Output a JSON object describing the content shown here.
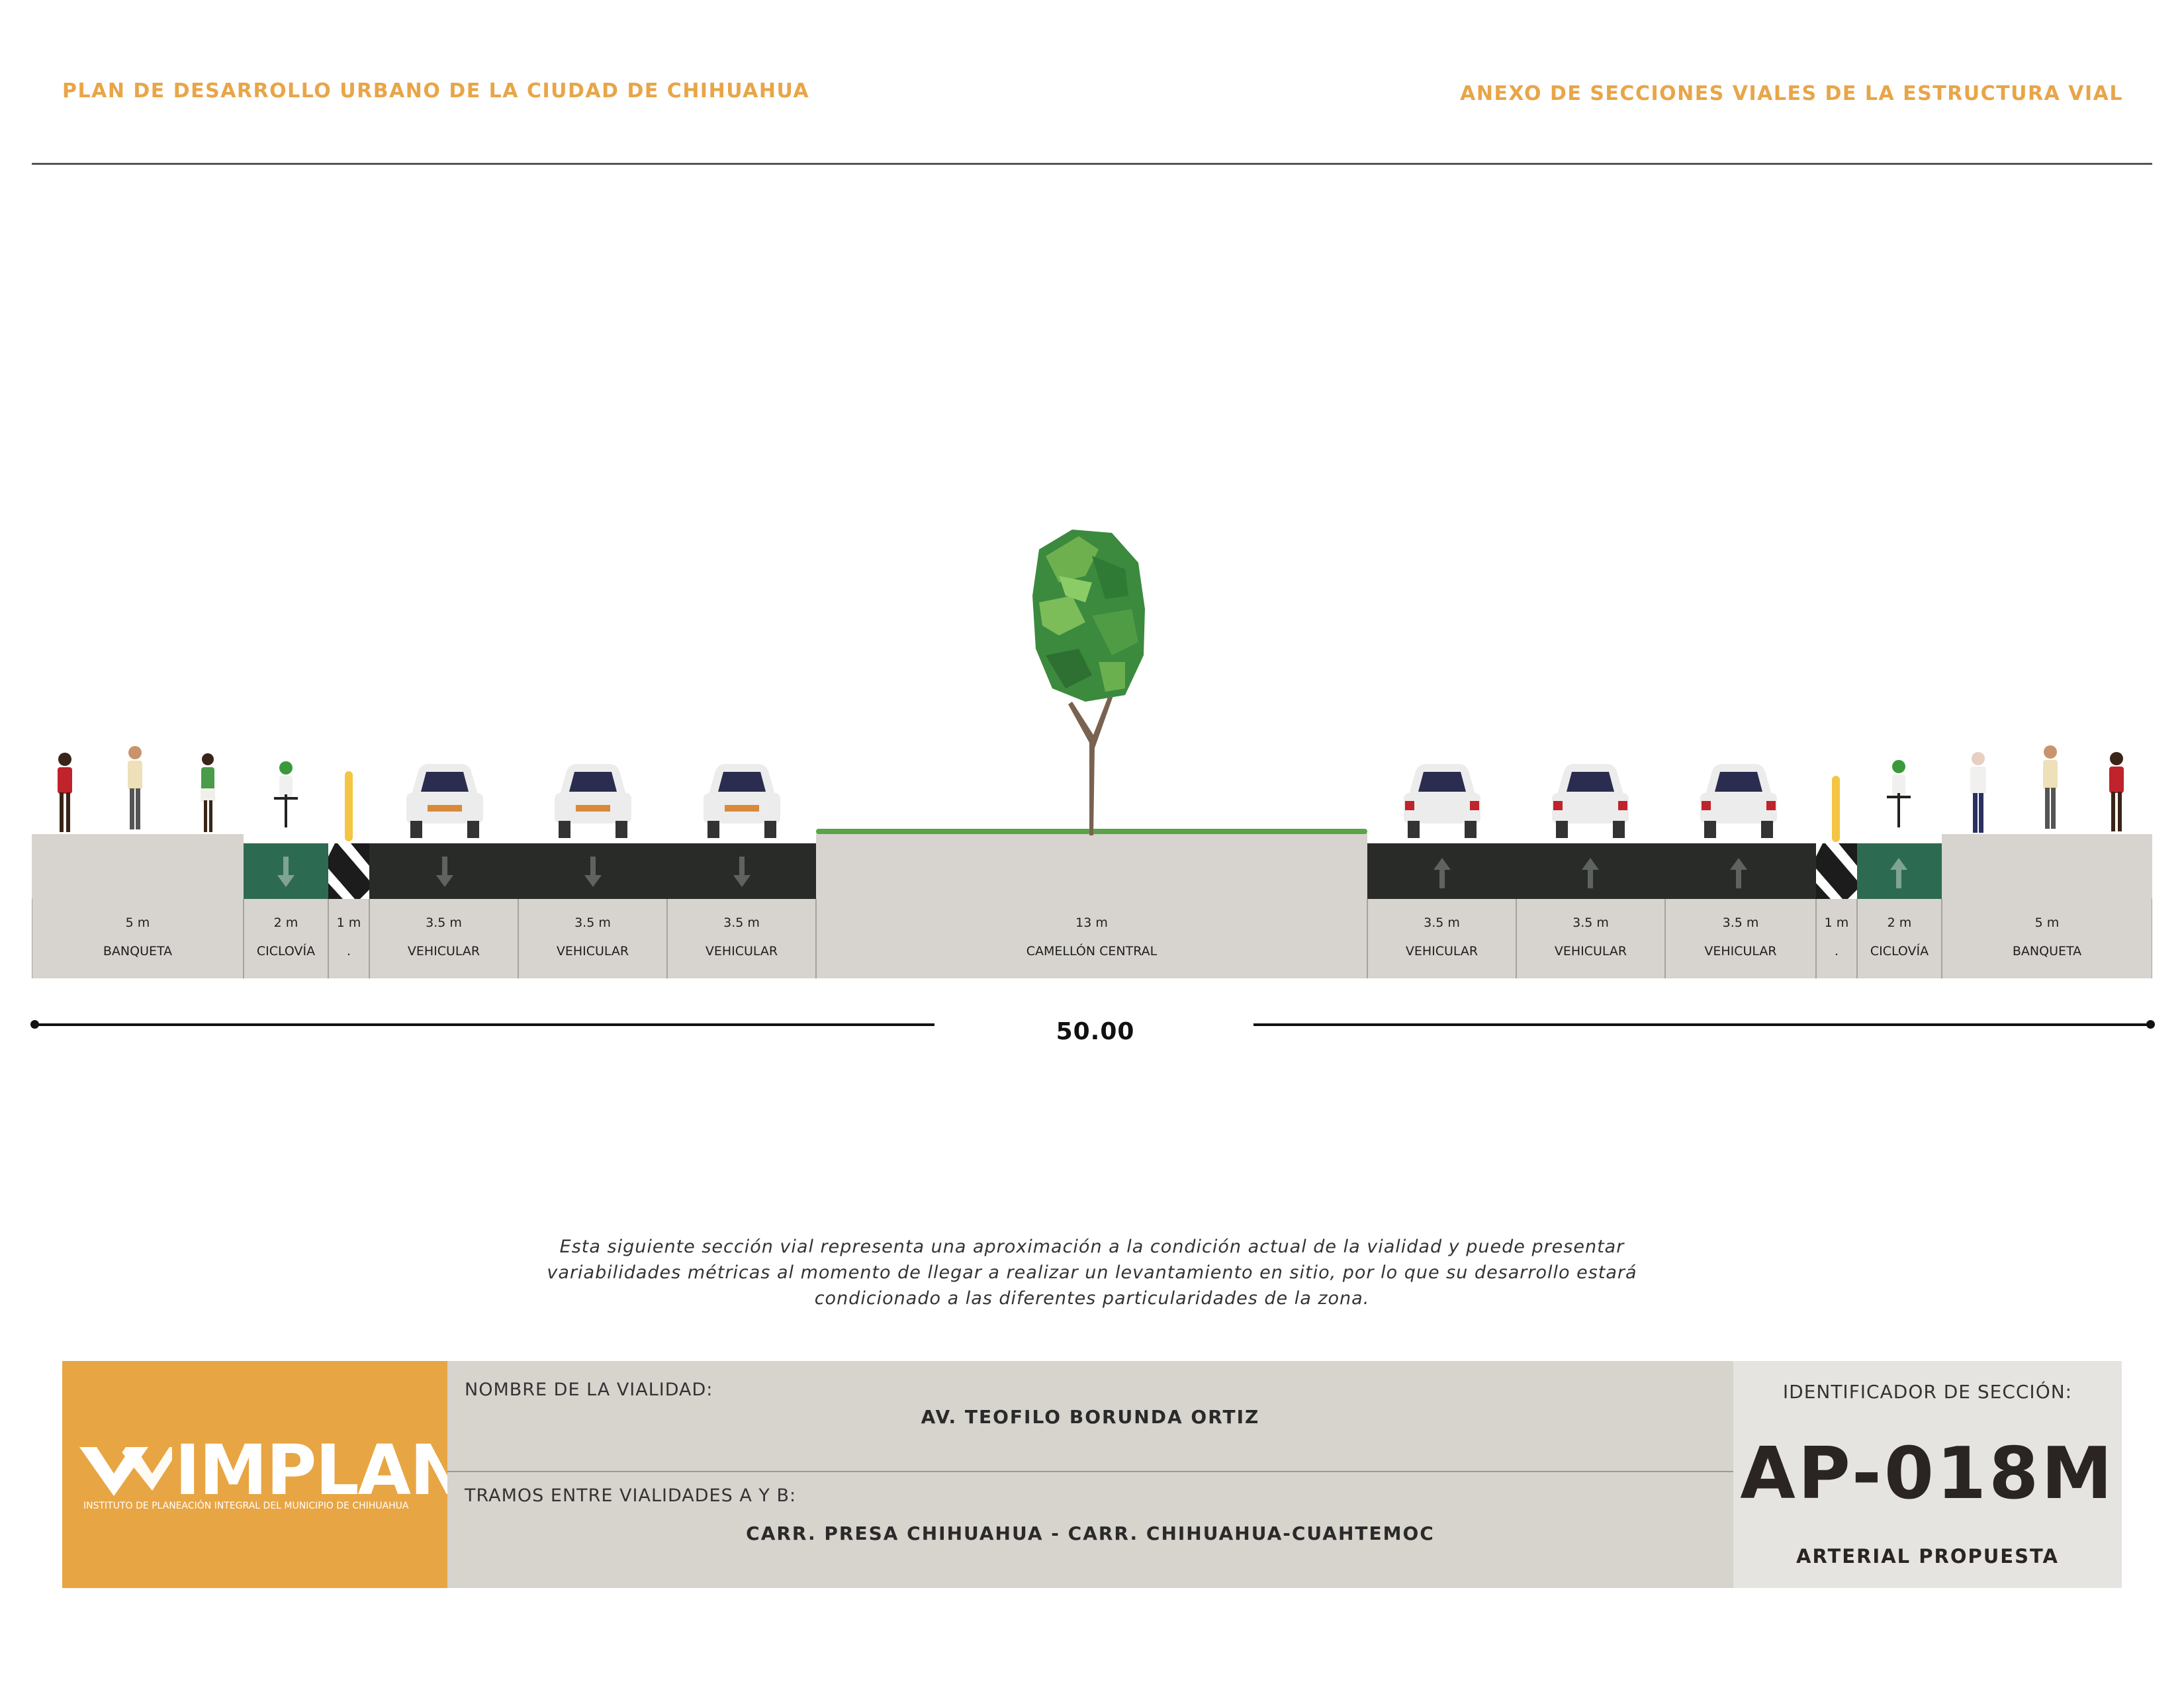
{
  "header": {
    "left_title": "PLAN DE DESARROLLO URBANO DE LA CIUDAD DE CHIHUAHUA",
    "right_title": "ANEXO DE SECCIONES VIALES DE LA ESTRUCTURA VIAL"
  },
  "section": {
    "segments": [
      {
        "width": "5 m",
        "label": "BANQUETA"
      },
      {
        "width": "2 m",
        "label": "CICLOVÍA"
      },
      {
        "width": "1 m",
        "label": "."
      },
      {
        "width": "3.5 m",
        "label": "VEHICULAR"
      },
      {
        "width": "3.5 m",
        "label": "VEHICULAR"
      },
      {
        "width": "3.5 m",
        "label": "VEHICULAR"
      },
      {
        "width": "13 m",
        "label": "CAMELLÓN CENTRAL"
      },
      {
        "width": "3.5 m",
        "label": "VEHICULAR"
      },
      {
        "width": "3.5 m",
        "label": "VEHICULAR"
      },
      {
        "width": "3.5 m",
        "label": "VEHICULAR"
      },
      {
        "width": "1 m",
        "label": "."
      },
      {
        "width": "2 m",
        "label": "CICLOVÍA"
      },
      {
        "width": "5 m",
        "label": "BANQUETA"
      }
    ],
    "total_width": "50.00",
    "colors": {
      "sidewalk": "#D7D4CF",
      "road": "#292B29",
      "bike_lane": "#2D6A52",
      "tree": "#3E8E41"
    }
  },
  "disclaimer": {
    "line1": "Esta siguiente sección vial representa una aproximación a la condición actual de la vialidad y puede presentar",
    "line2": "variabilidades métricas al momento de llegar a realizar un levantamiento en sitio, por lo que su desarrollo estará",
    "line3": "condicionado a las diferentes particularidades de la zona."
  },
  "footer": {
    "logo": {
      "name": "IMPLAN",
      "subtitle": "INSTITUTO DE PLANEACIÓN INTEGRAL DEL MUNICIPIO DE CHIHUAHUA",
      "color": "#E8A543"
    },
    "road_name_label": "NOMBRE DE LA VIALIDAD:",
    "road_name": "AV. TEOFILO BORUNDA ORTIZ",
    "segment_label": "TRAMOS ENTRE VIALIDADES A Y B:",
    "segment_value": "CARR. PRESA CHIHUAHUA - CARR. CHIHUAHUA-CUAHTEMOC",
    "id_label": "IDENTIFICADOR DE SECCIÓN:",
    "id_code": "AP-018M",
    "classification": "ARTERIAL PROPUESTA"
  }
}
